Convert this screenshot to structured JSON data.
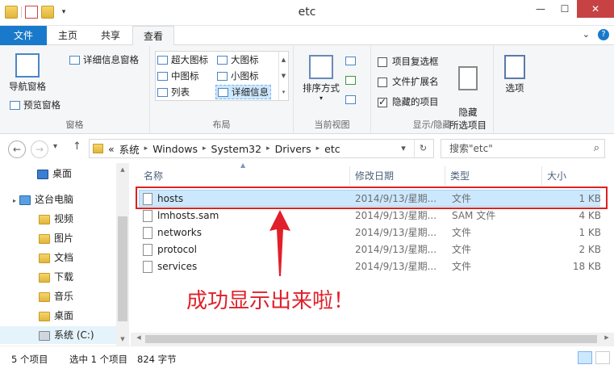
{
  "window": {
    "title": "etc"
  },
  "ribbon_tabs": [
    "文件",
    "主页",
    "共享",
    "查看"
  ],
  "ribbon": {
    "pane": {
      "nav_pane": "导航窗格",
      "preview_pane": "预览窗格",
      "details_pane": "详细信息窗格",
      "label": "窗格"
    },
    "layout": {
      "items": [
        "超大图标",
        "大图标",
        "中图标",
        "小图标",
        "列表",
        "详细信息"
      ],
      "selected": "详细信息",
      "label": "布局"
    },
    "current_view": {
      "sort_by": "排序方式",
      "label": "当前视图"
    },
    "show_hide": {
      "item_checkboxes": {
        "label": "项目复选框",
        "checked": false
      },
      "file_extensions": {
        "label": "文件扩展名",
        "checked": false
      },
      "hidden_items": {
        "label": "隐藏的项目",
        "checked": true
      },
      "hide_selected": "隐藏\n所选项目",
      "label": "显示/隐藏"
    },
    "options": "选项"
  },
  "address": {
    "overflow": "«",
    "crumbs": [
      "系统",
      "Windows",
      "System32",
      "Drivers",
      "etc"
    ],
    "search_placeholder": "搜索\"etc\""
  },
  "nav_pane": [
    {
      "label": "桌面",
      "icon": "desktop-icon"
    },
    {
      "label": "这台电脑",
      "icon": "computer-icon"
    },
    {
      "label": "视频",
      "icon": "folder-icon"
    },
    {
      "label": "图片",
      "icon": "folder-icon"
    },
    {
      "label": "文档",
      "icon": "folder-icon"
    },
    {
      "label": "下载",
      "icon": "folder-icon"
    },
    {
      "label": "音乐",
      "icon": "folder-icon"
    },
    {
      "label": "桌面",
      "icon": "folder-icon"
    },
    {
      "label": "系统 (C:)",
      "icon": "drive-icon"
    }
  ],
  "columns": [
    "名称",
    "修改日期",
    "类型",
    "大小"
  ],
  "files": [
    {
      "name": "hosts",
      "modified": "2014/9/13/星期...",
      "type": "文件",
      "size": "1 KB",
      "selected": true
    },
    {
      "name": "lmhosts.sam",
      "modified": "2014/9/13/星期...",
      "type": "SAM 文件",
      "size": "4 KB",
      "selected": false
    },
    {
      "name": "networks",
      "modified": "2014/9/13/星期...",
      "type": "文件",
      "size": "1 KB",
      "selected": false
    },
    {
      "name": "protocol",
      "modified": "2014/9/13/星期...",
      "type": "文件",
      "size": "2 KB",
      "selected": false
    },
    {
      "name": "services",
      "modified": "2014/9/13/星期...",
      "type": "文件",
      "size": "18 KB",
      "selected": false
    }
  ],
  "annotation": "成功显示出来啦！",
  "status": {
    "item_count": "5 个项目",
    "selection": "选中 1 个项目",
    "selection_size": "824 字节"
  },
  "colors": {
    "accent": "#1979ca",
    "selection": "#cce8ff",
    "annotation": "#e0202a"
  }
}
